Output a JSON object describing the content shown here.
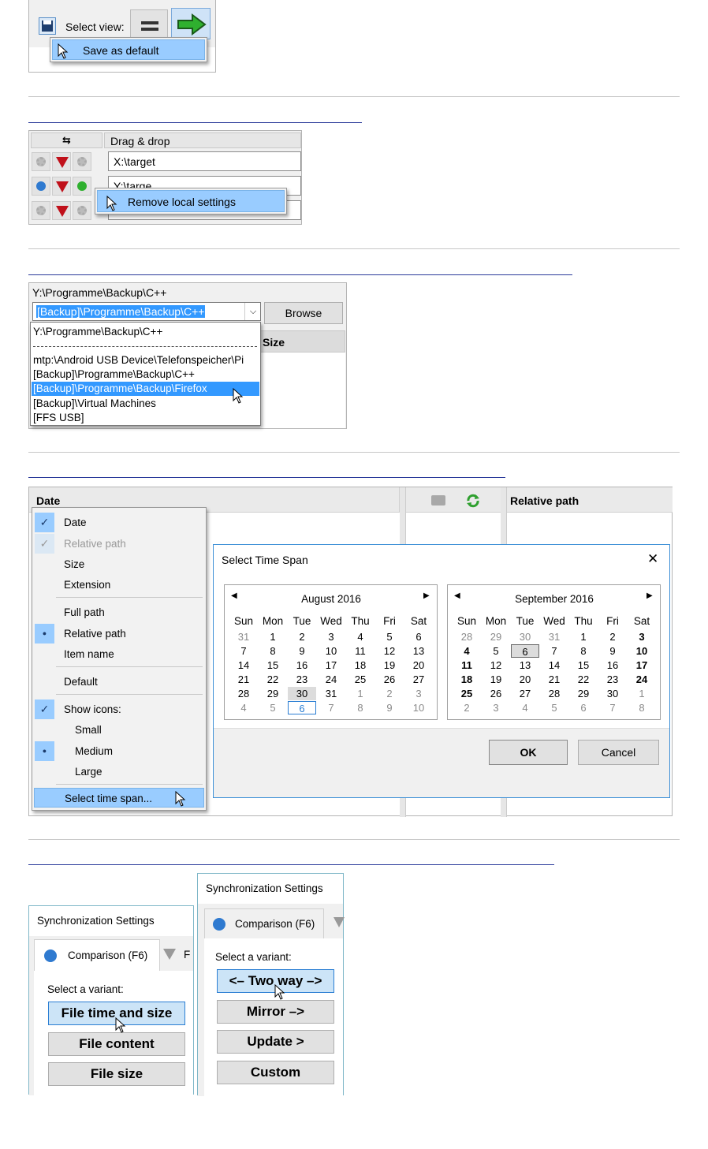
{
  "section1": {
    "select_view_label": "Select view:",
    "menu_item": "Save as default"
  },
  "section2": {
    "header_swap": "⇆",
    "header_label": "Drag & drop",
    "rows": [
      "X:\\target",
      "Y:\\targe",
      ""
    ],
    "menu_item": "Remove local settings"
  },
  "section3": {
    "path_label": "Y:\\Programme\\Backup\\C++",
    "combo_value": "[Backup]\\Programme\\Backup\\C++",
    "browse_label": "Browse",
    "size_header": "Size",
    "dropdown_items": [
      "Y:\\Programme\\Backup\\C++",
      "mtp:\\Android USB Device\\Telefonspeicher\\Pi",
      "[Backup]\\Programme\\Backup\\C++",
      "[Backup]\\Programme\\Backup\\Firefox",
      "[Backup]\\Virtual Machines",
      "[FFS USB]"
    ]
  },
  "section4": {
    "date_header": "Date",
    "relative_path_header": "Relative path",
    "context_menu": [
      {
        "label": "Date",
        "mark": "check"
      },
      {
        "label": "Relative path",
        "mark": "check-grey"
      },
      {
        "label": "Size",
        "mark": ""
      },
      {
        "label": "Extension",
        "mark": ""
      },
      {
        "label": "Full path",
        "mark": ""
      },
      {
        "label": "Relative path",
        "mark": "dot"
      },
      {
        "label": "Item name",
        "mark": ""
      },
      {
        "label": "Default",
        "mark": ""
      },
      {
        "label": "Show icons:",
        "mark": "check"
      },
      {
        "label": "Small",
        "mark": ""
      },
      {
        "label": "Medium",
        "mark": "dot"
      },
      {
        "label": "Large",
        "mark": ""
      },
      {
        "label": "Select time span...",
        "mark": ""
      }
    ],
    "dialog": {
      "title": "Select Time Span",
      "close": "✕",
      "ok": "OK",
      "cancel": "Cancel",
      "weekdays": [
        "Sun",
        "Mon",
        "Tue",
        "Wed",
        "Thu",
        "Fri",
        "Sat"
      ],
      "calendars": [
        {
          "title": "August 2016",
          "rows": [
            [
              "31",
              "1",
              "2",
              "3",
              "4",
              "5",
              "6"
            ],
            [
              "7",
              "8",
              "9",
              "10",
              "11",
              "12",
              "13"
            ],
            [
              "14",
              "15",
              "16",
              "17",
              "18",
              "19",
              "20"
            ],
            [
              "21",
              "22",
              "23",
              "24",
              "25",
              "26",
              "27"
            ],
            [
              "28",
              "29",
              "30",
              "31",
              "1",
              "2",
              "3"
            ],
            [
              "4",
              "5",
              "6",
              "7",
              "8",
              "9",
              "10"
            ]
          ]
        },
        {
          "title": "September 2016",
          "rows": [
            [
              "28",
              "29",
              "30",
              "31",
              "1",
              "2",
              "3"
            ],
            [
              "4",
              "5",
              "6",
              "7",
              "8",
              "9",
              "10"
            ],
            [
              "11",
              "12",
              "13",
              "14",
              "15",
              "16",
              "17"
            ],
            [
              "18",
              "19",
              "20",
              "21",
              "22",
              "23",
              "24"
            ],
            [
              "25",
              "26",
              "27",
              "28",
              "29",
              "30",
              "1"
            ],
            [
              "2",
              "3",
              "4",
              "5",
              "6",
              "7",
              "8"
            ]
          ]
        }
      ]
    }
  },
  "section5": {
    "panel_title": "Synchronization Settings",
    "tab_comparison": "Comparison (F6)",
    "select_variant": "Select a variant:",
    "left_variants": [
      "File time and size",
      "File content",
      "File size"
    ],
    "right_variants": [
      "<– Two way –>",
      "Mirror –>",
      "Update >",
      "Custom"
    ],
    "tab_f_partial": "F"
  },
  "colors": {
    "highlight": "#99ccff",
    "selected_button": "#cce4f7",
    "link_underline": "#2a3a9a",
    "filter_red": "#c0101a",
    "arrow_green": "#2fb02f"
  }
}
